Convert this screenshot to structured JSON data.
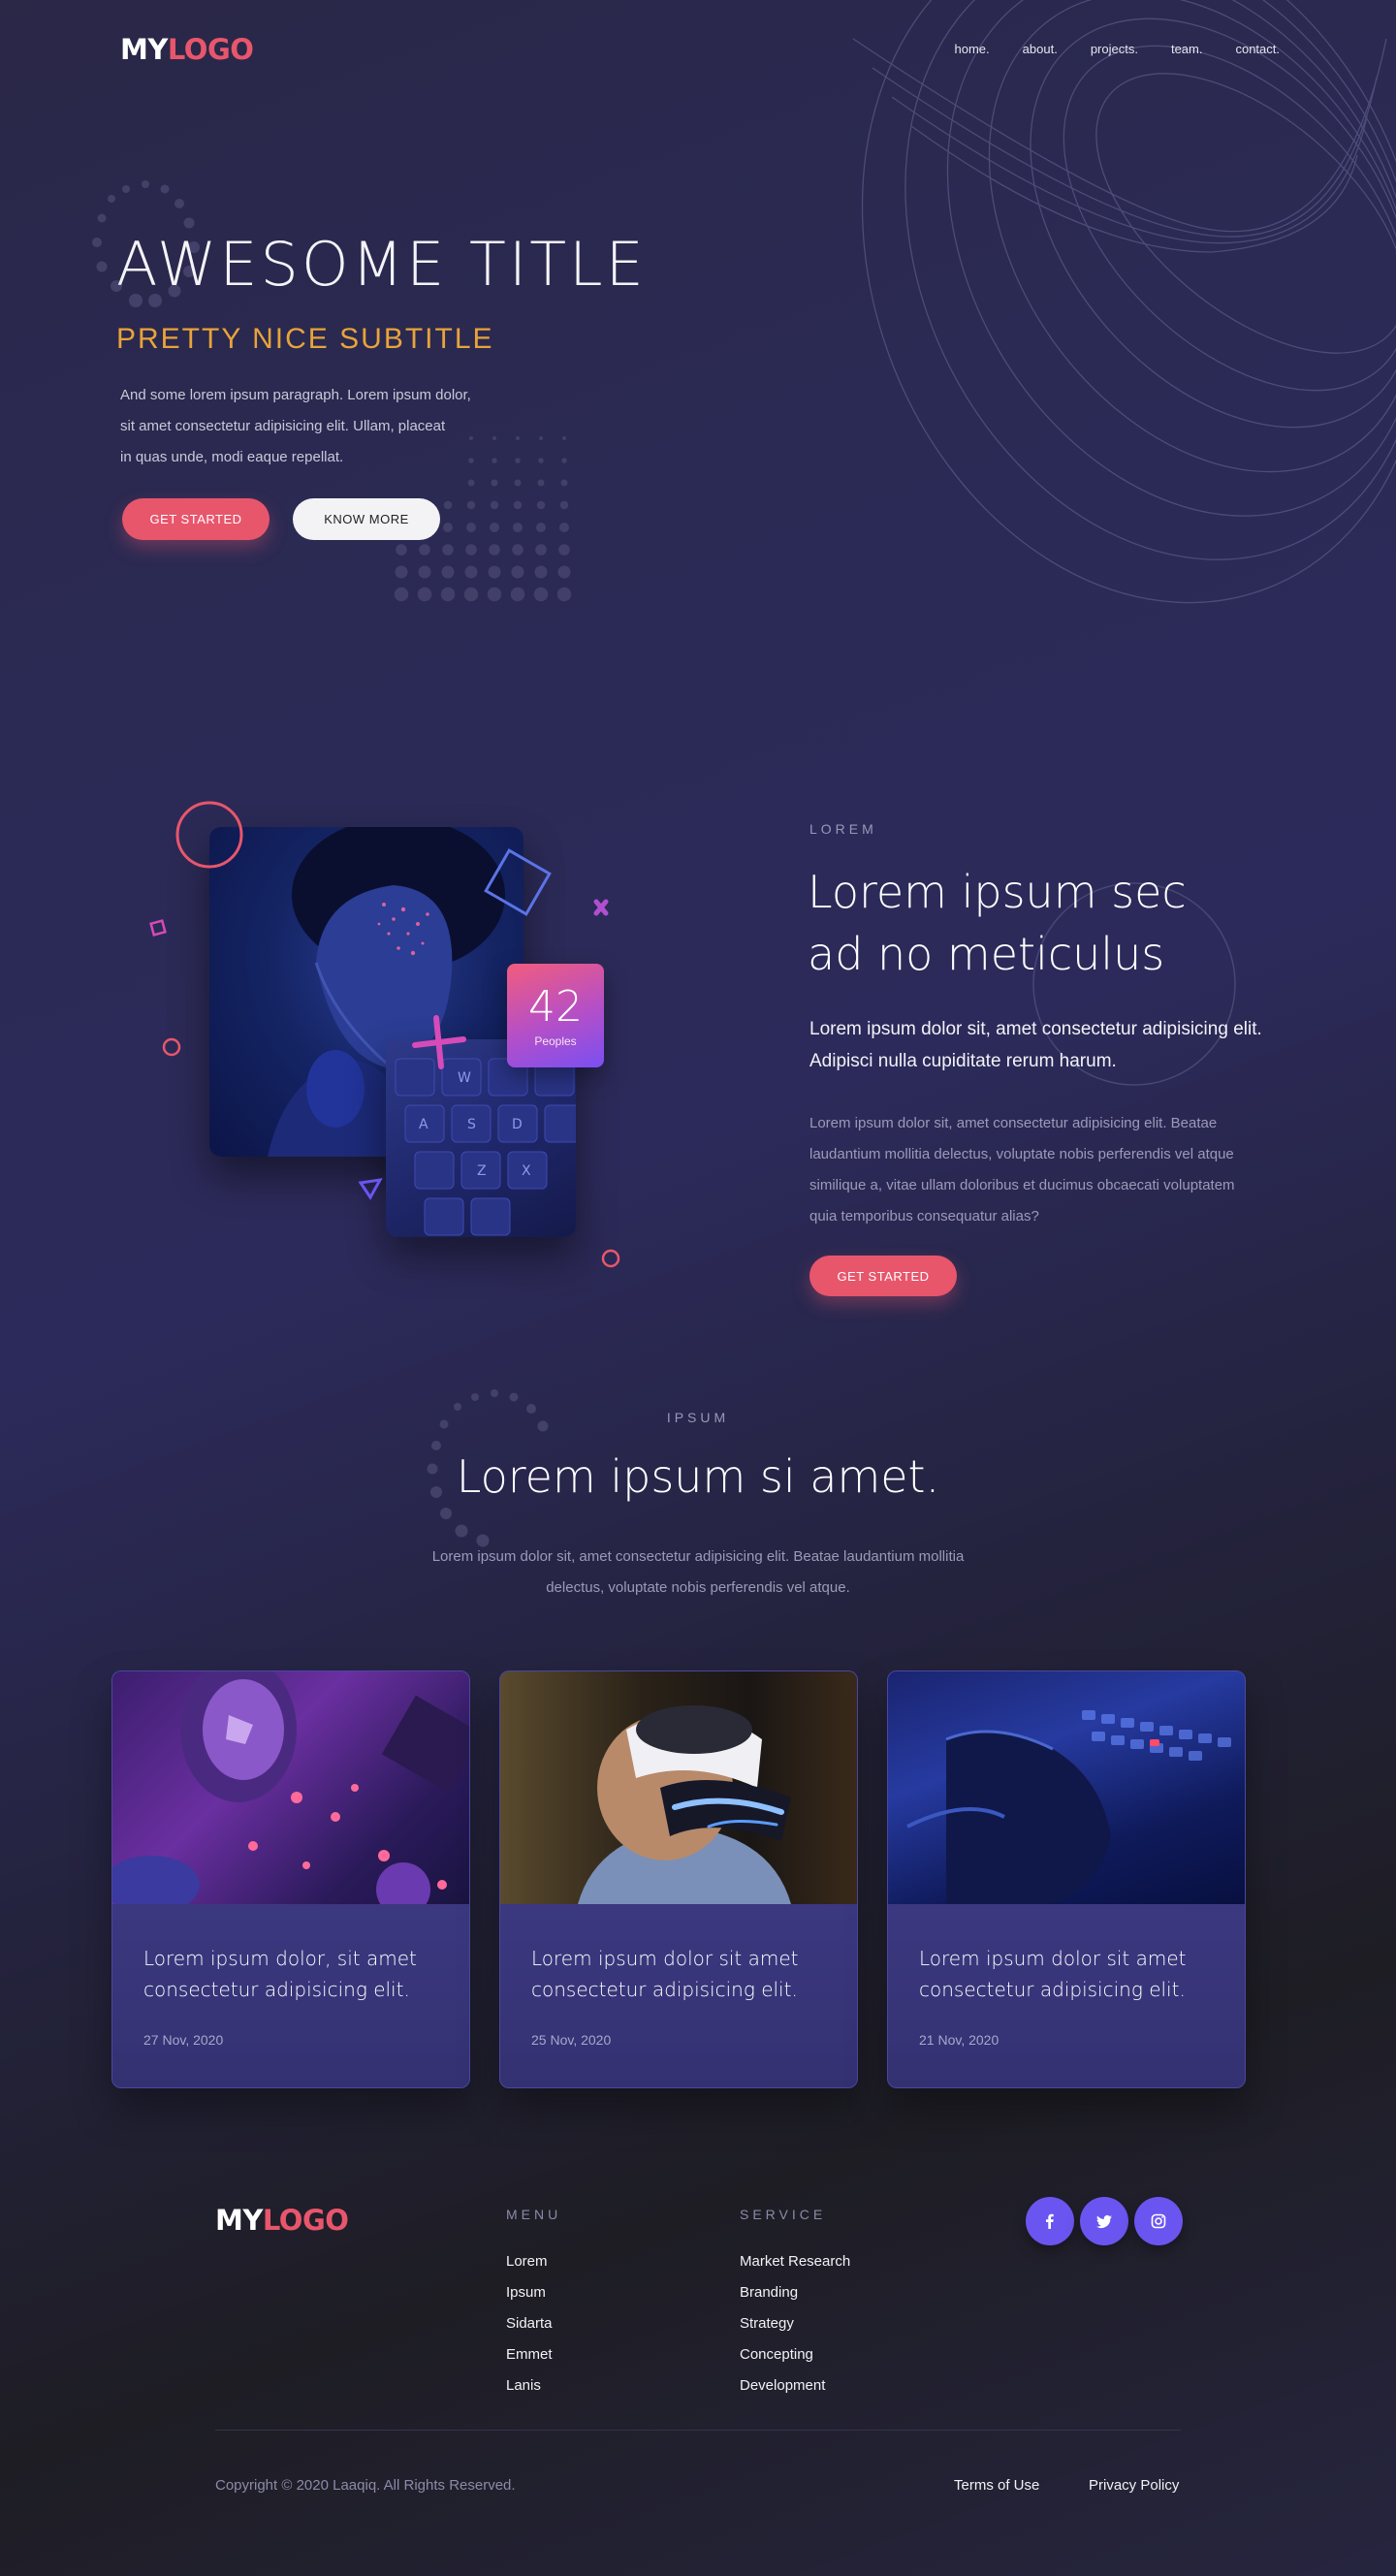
{
  "header": {
    "logo_my": "MY",
    "logo_logo": "LOGO",
    "nav": [
      "home.",
      "about.",
      "projects.",
      "team.",
      "contact."
    ]
  },
  "hero": {
    "title": "AWESOME TITLE",
    "subtitle": "PRETTY NICE SUBTITLE",
    "paragraph_lines": [
      "And some lorem ipsum paragraph. Lorem ipsum dolor,",
      "sit amet consectetur adipisicing elit. Ullam, placeat",
      "in quas unde, modi eaque repellat."
    ],
    "primary_button": "GET STARTED",
    "secondary_button": "KNOW MORE"
  },
  "about": {
    "eyebrow": "LOREM",
    "title_lines": [
      "Lorem ipsum sec",
      "ad no meticulus"
    ],
    "lead": "Lorem ipsum dolor sit, amet consectetur adipisicing elit. Adipisci nulla cupiditate rerum harum.",
    "paragraph": "Lorem ipsum dolor sit, amet consectetur adipisicing elit. Beatae laudantium mollitia delectus, voluptate nobis perferendis vel atque similique a, vitae ullam doloribus et ducimus obcaecati voluptatem quia temporibus consequatur alias?",
    "button": "GET STARTED",
    "stat": {
      "value": "42",
      "label": "Peoples"
    }
  },
  "ipsum": {
    "eyebrow": "IPSUM",
    "title": "Lorem ipsum si amet.",
    "paragraph": "Lorem ipsum dolor sit, amet consectetur adipisicing elit. Beatae laudantium mollitia delectus, voluptate nobis perferendis vel atque.",
    "cards": [
      {
        "title": "Lorem ipsum dolor, sit amet consectetur adipisicing elit.",
        "date": "27 Nov, 2020"
      },
      {
        "title": "Lorem ipsum dolor sit amet consectetur adipisicing elit.",
        "date": "25 Nov, 2020"
      },
      {
        "title": "Lorem ipsum dolor sit amet consectetur adipisicing elit.",
        "date": "21 Nov, 2020"
      }
    ]
  },
  "footer": {
    "logo_my": "MY",
    "logo_logo": "LOGO",
    "menu_heading": "MENU",
    "menu": [
      "Lorem",
      "Ipsum",
      "Sidarta",
      "Emmet",
      "Lanis"
    ],
    "service_heading": "SERVICE",
    "service": [
      "Market Research",
      "Branding",
      "Strategy",
      "Concepting",
      "Development"
    ],
    "social_icons": [
      "facebook-icon",
      "twitter-icon",
      "instagram-icon"
    ],
    "copyright": "Copyright © 2020 Laaqiq. All Rights Reserved.",
    "terms": "Terms of Use",
    "privacy": "Privacy Policy"
  },
  "colors": {
    "accent_red": "#e8566c",
    "subtitle_orange": "#e8a33a",
    "social_purple": "#6b55f0",
    "card_bg": "#383578"
  }
}
